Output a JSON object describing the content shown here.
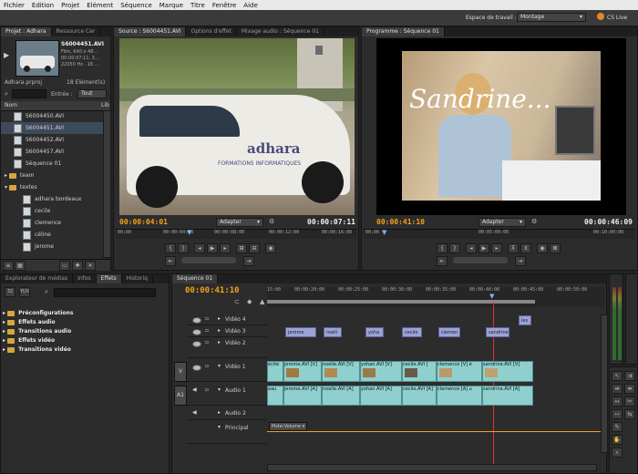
{
  "menu": [
    "Fichier",
    "Edition",
    "Projet",
    "Elément",
    "Séquence",
    "Marque",
    "Titre",
    "Fenêtre",
    "Aide"
  ],
  "workspace": {
    "label": "Espace de travail :",
    "value": "Montage",
    "cs_live": "CS Live"
  },
  "project": {
    "tabs": [
      "Projet : Adhara",
      "Ressource Cer"
    ],
    "clip_name": "S6004451.AVI",
    "clip_info1": "Film, 640 x 48...",
    "clip_info2": "00:00:07:11, 3...",
    "clip_info3": "22050 Hz - 16 ...",
    "project_file": "Adhara.prproj",
    "count": "18 Elément(s)",
    "entree_label": "Entrée :",
    "entree_value": "Tout",
    "col_name": "Nom",
    "col_label": "Lib",
    "items": [
      {
        "name": "S6004450.AVI",
        "type": "file",
        "indent": 1
      },
      {
        "name": "S6004451.AVI",
        "type": "file",
        "indent": 1
      },
      {
        "name": "S6004452.AVI",
        "type": "file",
        "indent": 1
      },
      {
        "name": "S6004457.AVI",
        "type": "file",
        "indent": 1
      },
      {
        "name": "Séquence 01",
        "type": "seq",
        "indent": 1
      },
      {
        "name": "team",
        "type": "folder",
        "indent": 0
      },
      {
        "name": "textes",
        "type": "folder",
        "indent": 0
      },
      {
        "name": "adhara bordeaux",
        "type": "file",
        "indent": 2
      },
      {
        "name": "cecile",
        "type": "file",
        "indent": 2
      },
      {
        "name": "clemence",
        "type": "file",
        "indent": 2
      },
      {
        "name": "céline",
        "type": "file",
        "indent": 2
      },
      {
        "name": "jerome",
        "type": "file",
        "indent": 2
      }
    ]
  },
  "source": {
    "tabs": [
      "Source : S6004451.AVI",
      "Options d'effet",
      "Mixage audio : Séquence 01"
    ],
    "car_brand": "adhara",
    "car_text": "FORMATIONS INFORMATIQUES",
    "timecode_in": "00:00:04:01",
    "fit": "Adapter",
    "timecode_dur": "00:00:07:11",
    "ruler": [
      "00;00",
      "00:00:04:00",
      "00:00:08:00",
      "00:00:12:00",
      "00:00:16:00"
    ]
  },
  "program": {
    "tabs": [
      "Programme : Séquence 01"
    ],
    "title_text": "Sandrine...",
    "timecode_in": "00:00:41:10",
    "fit": "Adapter",
    "timecode_dur": "00:00:46:09",
    "ruler": [
      "00;00",
      "00:05:00:00",
      "00:10:00:00"
    ]
  },
  "effects": {
    "tabs": [
      "Explorateur de médias",
      "Infos",
      "Effets",
      "Historiq"
    ],
    "items": [
      "Préconfigurations",
      "Effets audio",
      "Transitions audio",
      "Effets vidéo",
      "Transitions vidéo"
    ]
  },
  "timeline": {
    "tabs": [
      "Séquence 01"
    ],
    "timecode": "00:00:41:10",
    "ruler": [
      "15:00",
      "00:00:20:00",
      "00:00:25:00",
      "00:00:30:00",
      "00:00:35:00",
      "00:00:40:00",
      "00:00:45:00",
      "00:00:50:00"
    ],
    "tracks": {
      "v4": "Vidéo 4",
      "v3": "Vidéo 3",
      "v2": "Vidéo 2",
      "v1": "Vidéo 1",
      "a1": "Audio 1",
      "a2": "Audio 2",
      "master": "Principal",
      "v_target": "V",
      "a_target": "A1"
    },
    "titles_v4": [
      "les"
    ],
    "titles_v3": [
      "jerome",
      "noeli",
      "yoha",
      "cecile",
      "clemen",
      "sandrine"
    ],
    "video_clips": [
      "écité",
      "jerome.AVI [V]",
      "noelle.AVI [V]",
      "yohan.AVI [V]",
      "cecile.AVI [",
      "clemence [V] é",
      "sandrine.AVI [V]"
    ],
    "audio_clips": [
      "eau",
      "jerome.AVI [A]",
      "noelle.AVI [A]",
      "yohan.AVI [A]",
      "cecile.AVI [A]",
      "clemence [A] u",
      "sandrine.AVI [A]"
    ],
    "volume_label": "Piste:Volume"
  }
}
